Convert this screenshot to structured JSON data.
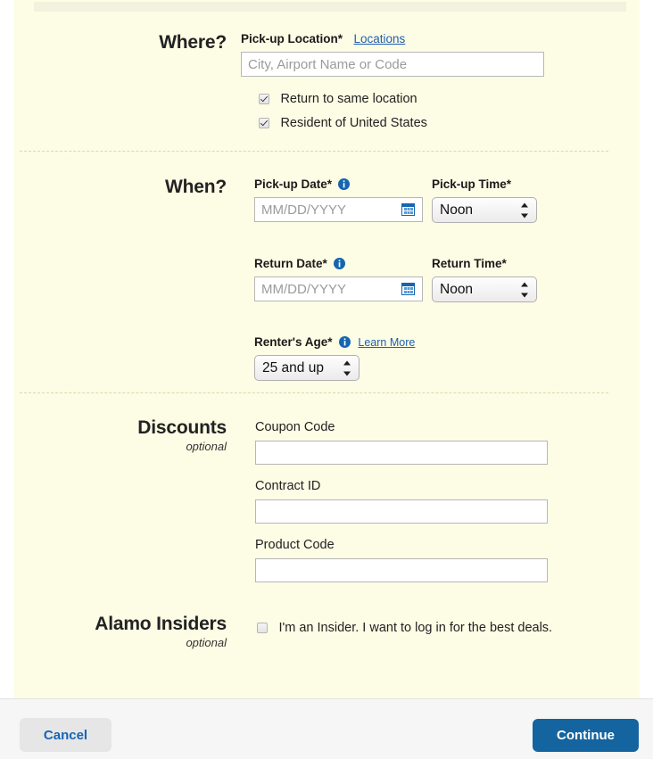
{
  "colors": {
    "panel_bg": "#fdfce5",
    "accent_blue": "#1464a0",
    "link_blue": "#1f5fae",
    "footer_bg": "#f6f6f6",
    "divider": "#ddd8b0"
  },
  "sections": {
    "where": {
      "title": "Where?",
      "pickup_location_label": "Pick-up Location*",
      "locations_link": "Locations",
      "pickup_location_value": "",
      "pickup_location_placeholder": "City, Airport Name or Code",
      "checkbox_same_location": {
        "label": "Return to same location",
        "checked": true
      },
      "checkbox_resident": {
        "label": "Resident of United States",
        "checked": true
      }
    },
    "when": {
      "title": "When?",
      "pickup_date_label": "Pick-up Date*",
      "pickup_date_value": "",
      "pickup_date_placeholder": "MM/DD/YYYY",
      "pickup_time_label": "Pick-up Time*",
      "pickup_time_value": "Noon",
      "return_date_label": "Return Date*",
      "return_date_value": "",
      "return_date_placeholder": "MM/DD/YYYY",
      "return_time_label": "Return Time*",
      "return_time_value": "Noon",
      "renters_age_label": "Renter's Age*",
      "learn_more_link": "Learn More",
      "renters_age_value": "25 and up"
    },
    "discounts": {
      "title": "Discounts",
      "subtitle": "optional",
      "coupon_label": "Coupon Code",
      "coupon_value": "",
      "contract_label": "Contract ID",
      "contract_value": "",
      "product_label": "Product Code",
      "product_value": ""
    },
    "insiders": {
      "title": "Alamo Insiders",
      "subtitle": "optional",
      "checkbox": {
        "label": "I'm an Insider. I want to log in for the best deals.",
        "checked": false
      }
    }
  },
  "footer": {
    "cancel_label": "Cancel",
    "continue_label": "Continue"
  }
}
